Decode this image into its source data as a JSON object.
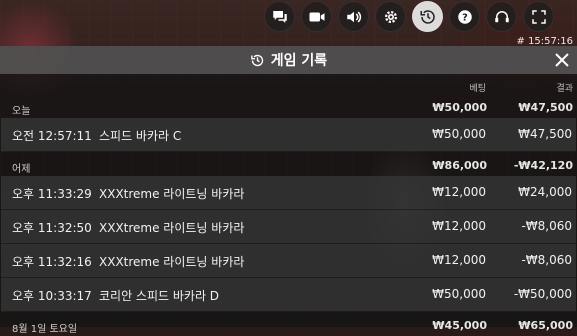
{
  "toolbar": {
    "buttons": [
      {
        "icon": "chat-icon"
      },
      {
        "icon": "video-camera-icon"
      },
      {
        "icon": "volume-icon"
      },
      {
        "icon": "gear-icon"
      },
      {
        "icon": "history-icon",
        "active": true
      },
      {
        "icon": "help-icon"
      },
      {
        "icon": "headset-icon"
      },
      {
        "icon": "fullscreen-icon"
      }
    ]
  },
  "clock": "# 15:57:16",
  "panel": {
    "title": "게임 기록",
    "columns": {
      "bet": "베팅",
      "result": "결과"
    }
  },
  "sections": [
    {
      "label": "오늘",
      "bet_total": "₩50,000",
      "result_total": "₩47,500",
      "rows": [
        {
          "time": "오전 12:57:11",
          "game": "스피드 바카라 C",
          "bet": "₩50,000",
          "result": "₩47,500"
        }
      ]
    },
    {
      "label": "어제",
      "bet_total": "₩86,000",
      "result_total": "-₩42,120",
      "rows": [
        {
          "time": "오후 11:33:29",
          "game": "XXXtreme 라이트닝 바카라",
          "bet": "₩12,000",
          "result": "₩24,000"
        },
        {
          "time": "오후 11:32:50",
          "game": "XXXtreme 라이트닝 바카라",
          "bet": "₩12,000",
          "result": "-₩8,060"
        },
        {
          "time": "오후 11:32:16",
          "game": "XXXtreme 라이트닝 바카라",
          "bet": "₩12,000",
          "result": "-₩8,060"
        },
        {
          "time": "오후 10:33:17",
          "game": "코리안 스피드 바카라 D",
          "bet": "₩50,000",
          "result": "-₩50,000"
        }
      ]
    },
    {
      "label": "8월 1일 토요일",
      "bet_total": "₩45,000",
      "result_total": "₩65,000",
      "rows": []
    }
  ],
  "colors": {
    "accent": "#ffffff",
    "panel_bg": "#141414",
    "header_bg": "#5f5f5f"
  }
}
